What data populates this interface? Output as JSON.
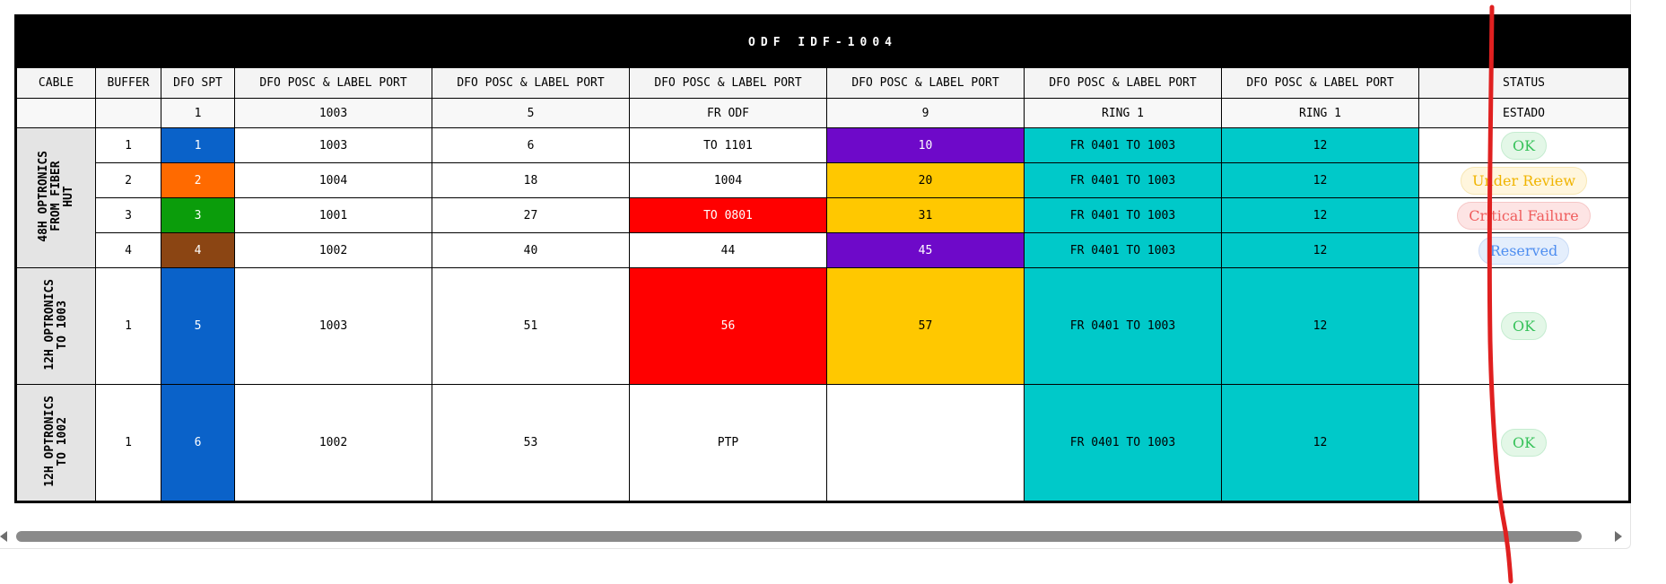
{
  "title": "ODF IDF-1004",
  "headers": [
    "CABLE",
    "BUFFER",
    "DFO SPT",
    "DFO POSC & LABEL PORT",
    "DFO POSC & LABEL PORT",
    "DFO POSC & LABEL PORT",
    "DFO POSC & LABEL PORT",
    "DFO POSC & LABEL PORT",
    "DFO POSC & LABEL PORT",
    "STATUS"
  ],
  "subheaders": [
    "",
    "",
    "1",
    "1003",
    "5",
    "FR ODF",
    "9",
    "RING 1",
    "RING 1",
    "ESTADO"
  ],
  "cables": [
    {
      "label": "48H OPTRONICS\nFROM FIBER\nHUT"
    },
    {
      "label": "12H OPTRONICS\nTO 1003"
    },
    {
      "label": "12H OPTRONICS\nTO 1002"
    }
  ],
  "rows": [
    {
      "buffer": "1",
      "spt": "1",
      "p1": "1003",
      "p2": "6",
      "p3": "TO 1101",
      "p4": "10",
      "p5": "FR 0401 TO 1003",
      "p6": "12",
      "status": "OK"
    },
    {
      "buffer": "2",
      "spt": "2",
      "p1": "1004",
      "p2": "18",
      "p3": "1004",
      "p4": "20",
      "p5": "FR 0401 TO 1003",
      "p6": "12",
      "status": "Under Review"
    },
    {
      "buffer": "3",
      "spt": "3",
      "p1": "1001",
      "p2": "27",
      "p3": "TO 0801",
      "p4": "31",
      "p5": "FR 0401 TO 1003",
      "p6": "12",
      "status": "Critical Failure"
    },
    {
      "buffer": "4",
      "spt": "4",
      "p1": "1002",
      "p2": "40",
      "p3": "44",
      "p4": "45",
      "p5": "FR 0401 TO 1003",
      "p6": "12",
      "status": "Reserved"
    },
    {
      "buffer": "1",
      "spt": "5",
      "p1": "1003",
      "p2": "51",
      "p3": "56",
      "p4": "57",
      "p5": "FR 0401 TO 1003",
      "p6": "12",
      "status": "OK"
    },
    {
      "buffer": "1",
      "spt": "6",
      "p1": "1002",
      "p2": "53",
      "p3": "PTP",
      "p4": "",
      "p5": "FR 0401 TO 1003",
      "p6": "12",
      "status": "OK"
    }
  ],
  "colors": {
    "blue": "#0a62c9",
    "orange": "#ff6a00",
    "green": "#0b9d0b",
    "brown": "#8b4513",
    "purple": "#6e09c9",
    "yellow": "#ffc800",
    "red": "#ff0000",
    "cyan": "#00c9c9",
    "annotation_stroke": "#e02020"
  },
  "icons": {
    "scroll_left": "triangle-left-icon",
    "scroll_right": "triangle-right-icon"
  }
}
